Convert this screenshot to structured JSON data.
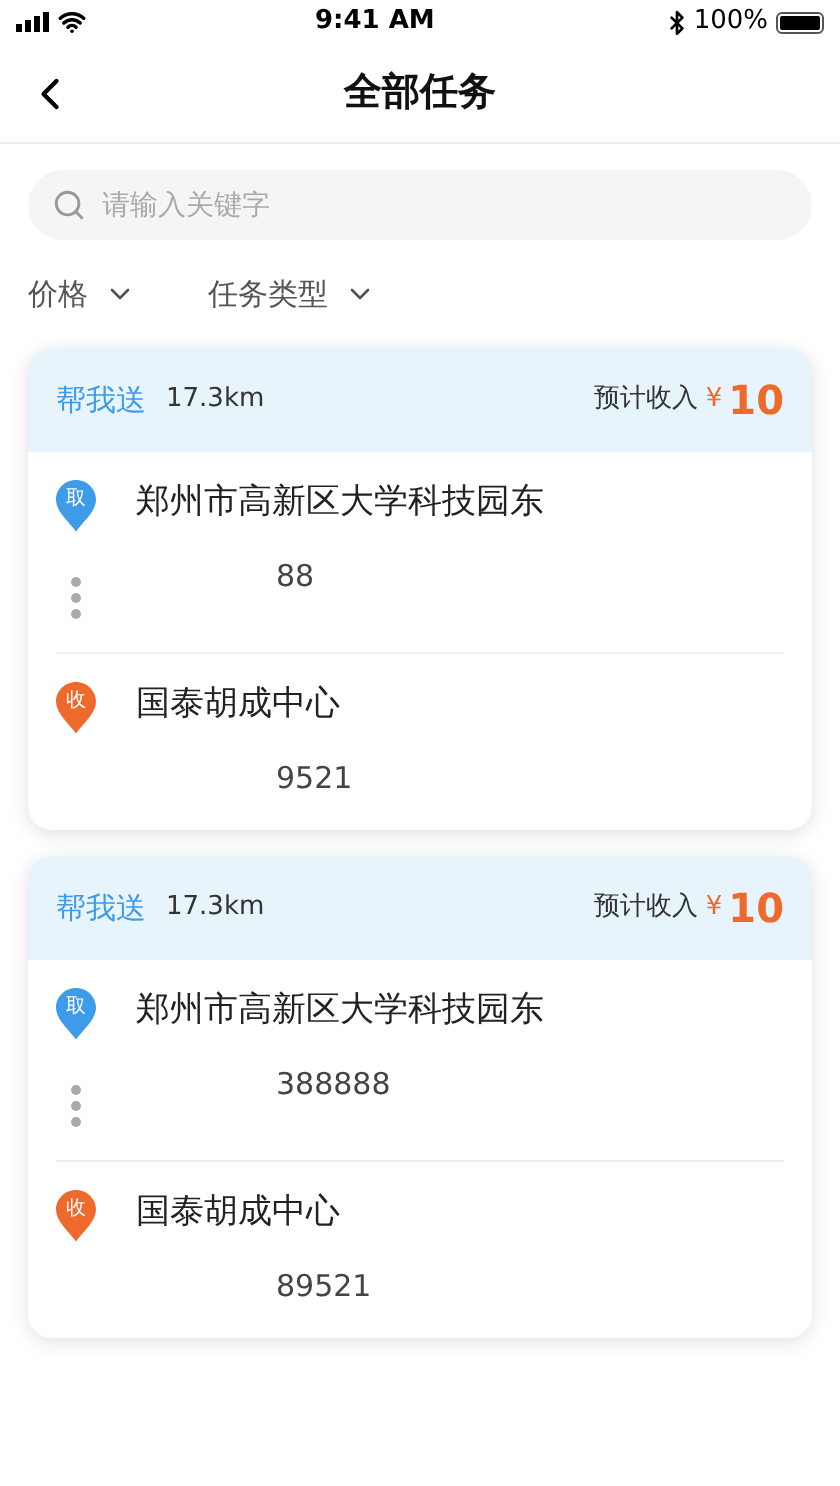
{
  "status_bar": {
    "time": "9:41 AM",
    "battery": "100%"
  },
  "nav": {
    "title": "全部任务"
  },
  "search": {
    "placeholder": "请输入关键字"
  },
  "filters": [
    {
      "label": "价格"
    },
    {
      "label": "任务类型"
    }
  ],
  "tasks": [
    {
      "type": "帮我送",
      "distance": "17.3km",
      "income_label": "预计收入",
      "currency": "¥",
      "income": "10",
      "stops": [
        {
          "kind": "pickup",
          "badge": "取",
          "address": "郑州市高新区大学科技园东",
          "contact": "88"
        },
        {
          "kind": "dropoff",
          "badge": "收",
          "address": "国泰胡成中心",
          "contact": "9521"
        }
      ]
    },
    {
      "type": "帮我送",
      "distance": "17.3km",
      "income_label": "预计收入",
      "currency": "¥",
      "income": "10",
      "stops": [
        {
          "kind": "pickup",
          "badge": "取",
          "address": "郑州市高新区大学科技园东",
          "contact": "388888"
        },
        {
          "kind": "dropoff",
          "badge": "收",
          "address": "国泰胡成中心",
          "contact": "89521"
        }
      ]
    }
  ]
}
